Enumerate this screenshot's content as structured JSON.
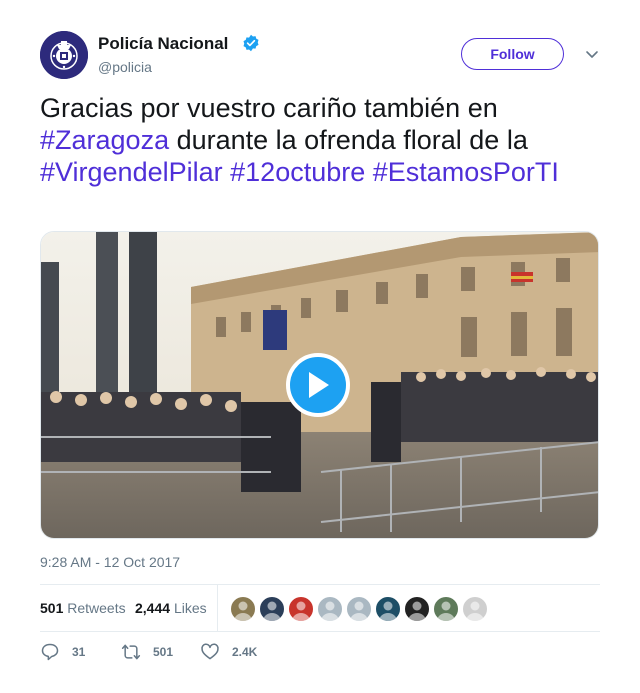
{
  "account": {
    "name": "Policía Nacional",
    "handle": "@policia",
    "verified": true,
    "brand_color": "#2d2a7c"
  },
  "follow_label": "Follow",
  "tweet": {
    "segments": [
      {
        "text": "Gracias por vuestro cariño también en ",
        "type": "text"
      },
      {
        "text": "#Zaragoza",
        "type": "hashtag"
      },
      {
        "text": " durante la ofrenda floral de la ",
        "type": "text"
      },
      {
        "text": "#VirgendelPilar",
        "type": "hashtag"
      },
      {
        "text": " ",
        "type": "text"
      },
      {
        "text": "#12octubre",
        "type": "hashtag"
      },
      {
        "text": " ",
        "type": "text"
      },
      {
        "text": "#EstamosPorTI",
        "type": "hashtag"
      }
    ],
    "hashtag_color": "#4f2fd8"
  },
  "media": {
    "type": "video",
    "play_icon": "play-icon"
  },
  "timestamp": "9:28 AM - 12 Oct 2017",
  "stats": {
    "retweets_count": "501",
    "retweets_label": "Retweets",
    "likes_count": "2,444",
    "likes_label": "Likes"
  },
  "likers": [
    {
      "color": "#8a7a52"
    },
    {
      "color": "#2b3e59"
    },
    {
      "color": "#c8342c"
    },
    {
      "color": "#aab8c2"
    },
    {
      "color": "#aab8c2"
    },
    {
      "color": "#1d4e66"
    },
    {
      "color": "#222222"
    },
    {
      "color": "#5e7a5a"
    },
    {
      "color": "#cfcfcf"
    }
  ],
  "actions": {
    "replies": "31",
    "retweets": "501",
    "likes": "2.4K"
  }
}
